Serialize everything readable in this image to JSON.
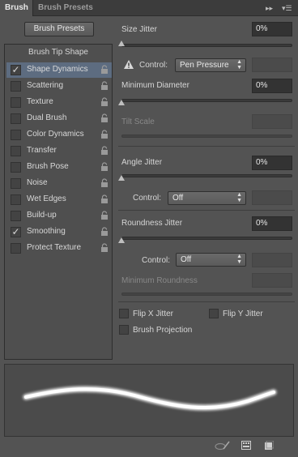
{
  "tabs": [
    {
      "label": "Brush",
      "active": true
    },
    {
      "label": "Brush Presets",
      "active": false
    }
  ],
  "brush_presets_button": "Brush Presets",
  "left_list": {
    "title": "Brush Tip Shape",
    "items": [
      {
        "label": "Shape Dynamics",
        "checked": true,
        "selected": true
      },
      {
        "label": "Scattering",
        "checked": false,
        "selected": false
      },
      {
        "label": "Texture",
        "checked": false,
        "selected": false
      },
      {
        "label": "Dual Brush",
        "checked": false,
        "selected": false
      },
      {
        "label": "Color Dynamics",
        "checked": false,
        "selected": false
      },
      {
        "label": "Transfer",
        "checked": false,
        "selected": false
      },
      {
        "label": "Brush Pose",
        "checked": false,
        "selected": false
      },
      {
        "label": "Noise",
        "checked": false,
        "selected": false
      },
      {
        "label": "Wet Edges",
        "checked": false,
        "selected": false
      },
      {
        "label": "Build-up",
        "checked": false,
        "selected": false
      },
      {
        "label": "Smoothing",
        "checked": true,
        "selected": false
      },
      {
        "label": "Protect Texture",
        "checked": false,
        "selected": false
      }
    ]
  },
  "right": {
    "size_jitter": {
      "label": "Size Jitter",
      "value": "0%"
    },
    "control1": {
      "label": "Control:",
      "value": "Pen Pressure"
    },
    "min_diameter": {
      "label": "Minimum Diameter",
      "value": "0%"
    },
    "tilt_scale": {
      "label": "Tilt Scale"
    },
    "angle_jitter": {
      "label": "Angle Jitter",
      "value": "0%"
    },
    "control2": {
      "label": "Control:",
      "value": "Off"
    },
    "roundness_jitter": {
      "label": "Roundness Jitter",
      "value": "0%"
    },
    "control3": {
      "label": "Control:",
      "value": "Off"
    },
    "min_roundness": {
      "label": "Minimum Roundness"
    },
    "flip_x": {
      "label": "Flip X Jitter",
      "checked": false
    },
    "flip_y": {
      "label": "Flip Y Jitter",
      "checked": false
    },
    "brush_projection": {
      "label": "Brush Projection",
      "checked": false
    }
  },
  "icons": [
    "panel-menu-icon",
    "collapse-icon",
    "lock-icon",
    "warning-icon",
    "pressure-toggle-icon",
    "new-preset-icon",
    "create-brush-icon"
  ],
  "colors": {
    "selected_row": "#5d6c80",
    "panel_bg": "#535353"
  }
}
